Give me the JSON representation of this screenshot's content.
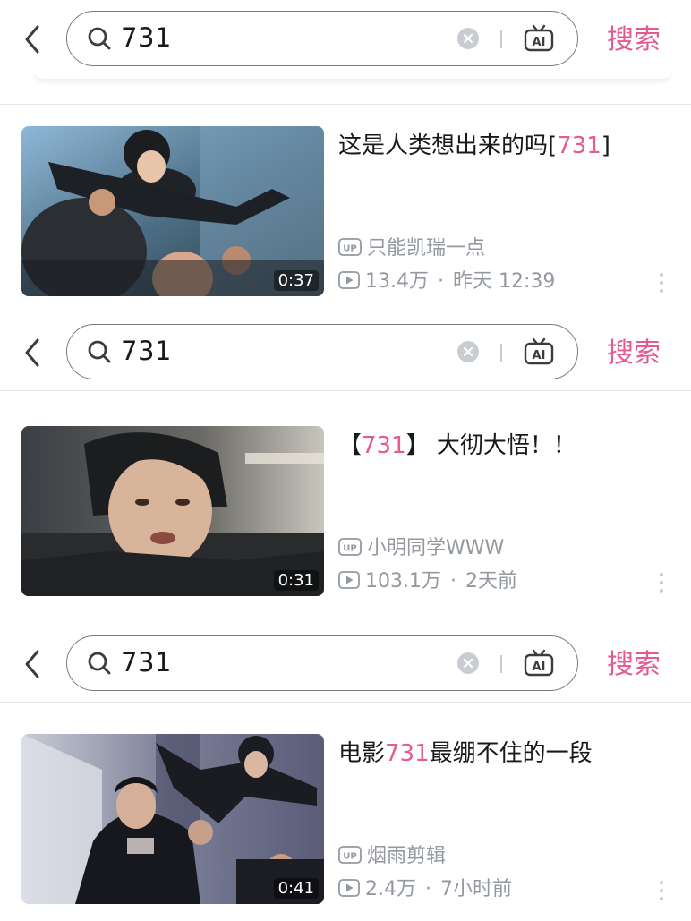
{
  "search": {
    "query": "731",
    "button_label": "搜索",
    "ai_label": "AI"
  },
  "results": [
    {
      "title_prefix": "这是人类想出来的吗[",
      "title_highlight": "731",
      "title_suffix": "]",
      "duration": "0:37",
      "uploader": "只能凯瑞一点",
      "views": "13.4万",
      "time": "昨天 12:39"
    },
    {
      "title_prefix": "【",
      "title_highlight": "731",
      "title_suffix": "】 大彻大悟！！",
      "duration": "0:31",
      "uploader": "小明同学WWW",
      "views": "103.1万",
      "time": "2天前"
    },
    {
      "title_prefix": "电影",
      "title_highlight": "731",
      "title_suffix": "最绷不住的一段",
      "duration": "0:41",
      "uploader": "烟雨剪辑",
      "views": "2.4万",
      "time": "7小时前"
    }
  ],
  "meta_separator": "·",
  "up_badge": "UP",
  "colors": {
    "accent": "#e45a92",
    "meta_text": "#9499a0",
    "title_text": "#18191c"
  },
  "icons": [
    "back-arrow-icon",
    "search-icon",
    "clear-icon",
    "ai-tv-icon",
    "up-badge-icon",
    "play-count-icon",
    "more-icon"
  ]
}
